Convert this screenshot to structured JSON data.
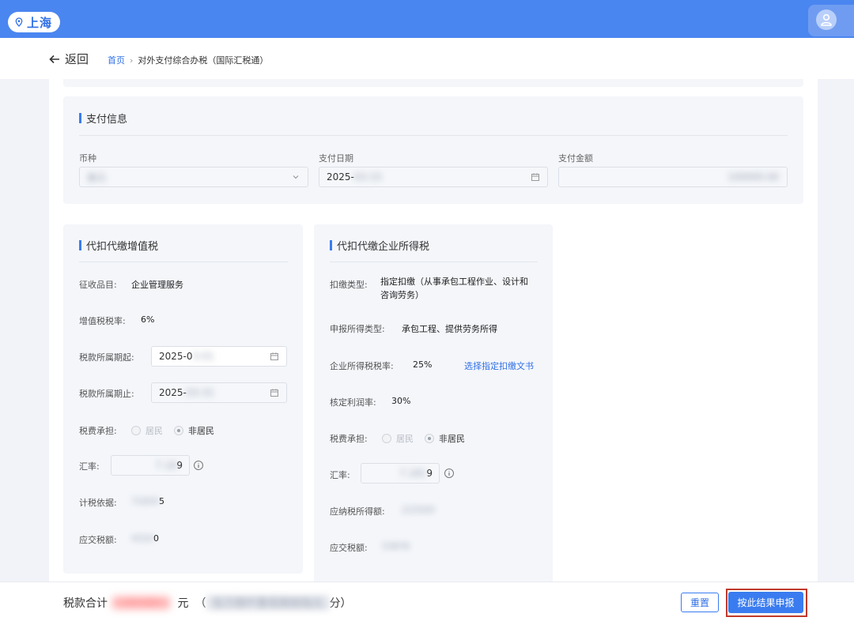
{
  "header": {
    "city": "上海",
    "accent_color": "#4a86f0"
  },
  "nav": {
    "back_label": "返回",
    "breadcrumb_home": "首页",
    "breadcrumb_separator": "›",
    "breadcrumb_current": "对外支付综合办税（国际汇税通）"
  },
  "payment": {
    "title": "支付信息",
    "currency_label": "币种",
    "currency_value": "美元",
    "date_label": "支付日期",
    "date_value": "2025-",
    "date_hidden": "03-15",
    "amount_label": "支付金额",
    "amount_value": "100000.00"
  },
  "vat": {
    "title": "代扣代缴增值税",
    "item_label": "征收品目:",
    "item_value": "企业管理服务",
    "rate_label": "增值税税率:",
    "rate_value": "6%",
    "start_label": "税款所属期起:",
    "start_value": "2025-0",
    "start_hidden": "3-01",
    "end_label": "税款所属期止:",
    "end_value": "2025-",
    "end_hidden": "03-31",
    "bearer_label": "税费承担:",
    "resident": "居民",
    "nonresident": "非居民",
    "exrate_label": "汇率:",
    "exrate_hidden": "7.18",
    "exrate_value": "9",
    "base_label": "计税依据:",
    "base_hidden": "71835",
    "base_value": "5",
    "tax_label": "应交税额:",
    "tax_hidden": "4310",
    "tax_value": "0"
  },
  "cit": {
    "title": "代扣代缴企业所得税",
    "type_label": "扣缴类型:",
    "type_value_line1": "指定扣缴（从事承包工程作业、设计和",
    "type_value_line2": "咨询劳务）",
    "income_type_label": "申报所得类型:",
    "income_type_value": "承包工程、提供劳务所得",
    "cit_rate_label": "企业所得税税率:",
    "cit_rate_value": "25%",
    "doc_link": "选择指定扣缴文书",
    "profit_label": "核定利润率:",
    "profit_value": "30%",
    "bearer_label": "税费承担:",
    "resident": "居民",
    "nonresident": "非居民",
    "exrate_label": "汇率:",
    "exrate_hidden": "7.181",
    "exrate_value": "9",
    "taxable_label": "应纳税所得额:",
    "taxable_hidden": "215505",
    "tax_label": "应交税额:",
    "tax_hidden": "53876"
  },
  "footer": {
    "total_label": "税款合计",
    "total_hidden": "58186",
    "yuan": "元",
    "open_paren": "（",
    "words_hidden": "伍万捌仟壹佰捌拾陆元",
    "words_tail": "分）",
    "reset_label": "重置",
    "submit_label": "按此结果申报"
  }
}
